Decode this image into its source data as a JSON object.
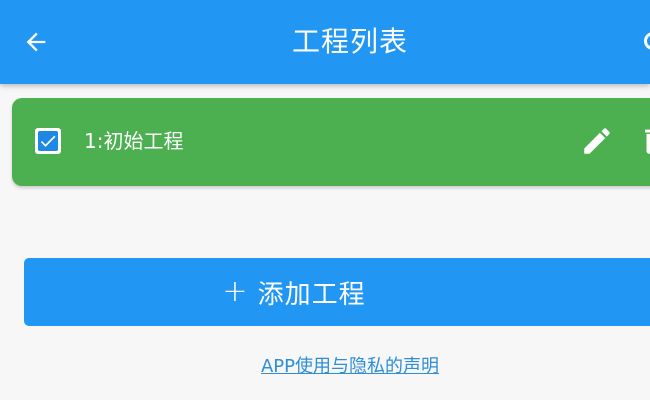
{
  "app_bar": {
    "title": "工程列表",
    "back_icon": "arrow-back-icon",
    "overflow_icon": "more-icon",
    "color": "#2196f3"
  },
  "projects": [
    {
      "label": "1:初始工程",
      "checked": true,
      "color": "#4caf50",
      "edit_icon": "pencil-icon",
      "delete_icon": "trash-icon"
    }
  ],
  "add_button": {
    "icon": "plus-icon",
    "plus": "+",
    "label": "添加工程",
    "color": "#2196f3"
  },
  "privacy_link": {
    "label": "APP使用与隐私的声明",
    "color": "#2f8ed8"
  }
}
